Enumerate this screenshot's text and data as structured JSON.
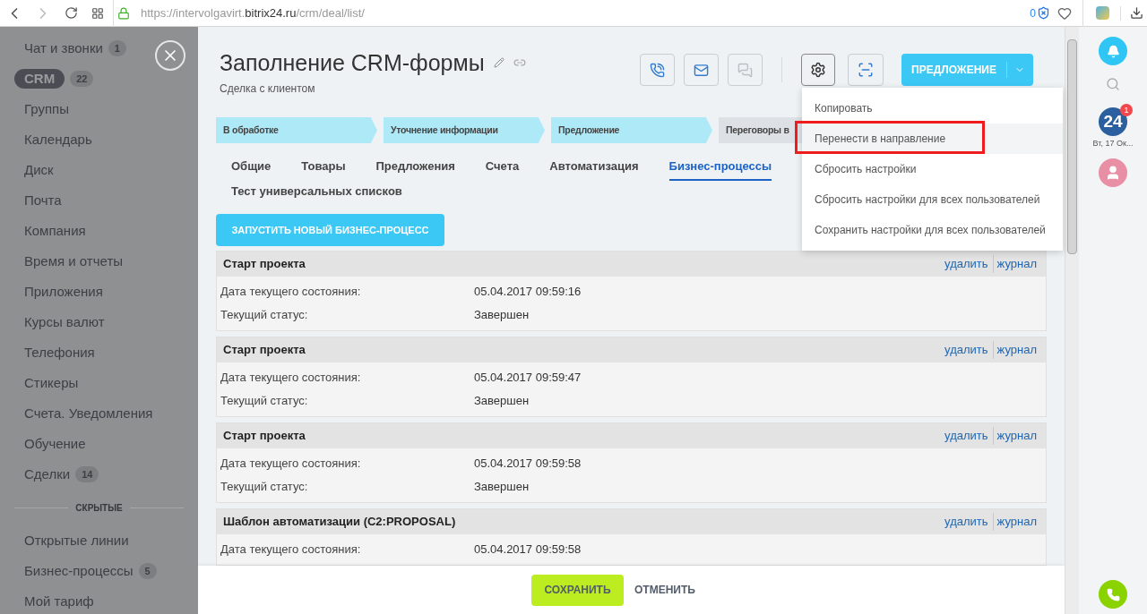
{
  "browser": {
    "url_prefix": "https://intervolgavirt.",
    "url_domain": "bitrix24.ru",
    "url_path": "/crm/deal/list/",
    "blocked_count": "0"
  },
  "sidebar": {
    "items": [
      {
        "label": "Чат и звонки",
        "count": "1",
        "selected": false
      },
      {
        "label": "CRM",
        "count": "22",
        "selected": true
      },
      {
        "label": "Группы",
        "selected": false
      },
      {
        "label": "Календарь",
        "selected": false
      },
      {
        "label": "Диск",
        "selected": false
      },
      {
        "label": "Почта",
        "selected": false
      },
      {
        "label": "Компания",
        "selected": false
      },
      {
        "label": "Время и отчеты",
        "selected": false
      },
      {
        "label": "Приложения",
        "selected": false
      },
      {
        "label": "Курсы валют",
        "selected": false
      },
      {
        "label": "Телефония",
        "selected": false
      },
      {
        "label": "Стикеры",
        "selected": false
      },
      {
        "label": "Счета. Уведомления",
        "selected": false
      },
      {
        "label": "Обучение",
        "selected": false
      },
      {
        "label": "Сделки",
        "count": "14",
        "selected": false
      }
    ],
    "hidden_heading": "СКРЫТЫЕ",
    "hidden_items": [
      {
        "label": "Открытые линии",
        "selected": false
      },
      {
        "label": "Бизнес-процессы",
        "count": "5",
        "selected": false
      },
      {
        "label": "Мой тариф",
        "selected": false
      }
    ]
  },
  "header": {
    "title": "Заполнение CRM-формы",
    "subtitle": "Сделка с клиентом",
    "primary_button": "ПРЕДЛОЖЕНИЕ"
  },
  "stages": [
    {
      "label": "В обработке",
      "passed": true
    },
    {
      "label": "Уточнение информации",
      "passed": true
    },
    {
      "label": "Предложение",
      "passed": true
    },
    {
      "label": "Переговоры в",
      "passed": false
    }
  ],
  "tabs": [
    {
      "label": "Общие",
      "selected": false
    },
    {
      "label": "Товары",
      "selected": false
    },
    {
      "label": "Предложения",
      "selected": false
    },
    {
      "label": "Счета",
      "selected": false
    },
    {
      "label": "Автоматизация",
      "selected": false
    },
    {
      "label": "Бизнес-процессы",
      "selected": true
    },
    {
      "label": "Тест универсальных списков",
      "selected": false
    }
  ],
  "start_button": "ЗАПУСТИТЬ НОВЫЙ БИЗНЕС-ПРОЦЕСС",
  "processes": [
    {
      "title": "Старт проекта",
      "delete": "удалить",
      "log": "журнал",
      "rows": [
        {
          "label": "Дата текущего состояния:",
          "value": "05.04.2017 09:59:16"
        },
        {
          "label": "Текущий статус:",
          "value": "Завершен"
        }
      ]
    },
    {
      "title": "Старт проекта",
      "delete": "удалить",
      "log": "журнал",
      "rows": [
        {
          "label": "Дата текущего состояния:",
          "value": "05.04.2017 09:59:47"
        },
        {
          "label": "Текущий статус:",
          "value": "Завершен"
        }
      ]
    },
    {
      "title": "Старт проекта",
      "delete": "удалить",
      "log": "журнал",
      "rows": [
        {
          "label": "Дата текущего состояния:",
          "value": "05.04.2017 09:59:58"
        },
        {
          "label": "Текущий статус:",
          "value": "Завершен"
        }
      ]
    },
    {
      "title": "Шаблон автоматизации (C2:PROPOSAL)",
      "delete": "удалить",
      "log": "журнал",
      "rows": [
        {
          "label": "Дата текущего состояния:",
          "value": "05.04.2017 09:59:58"
        }
      ]
    }
  ],
  "menu": [
    {
      "label": "Копировать",
      "selected": false,
      "highlighted": false
    },
    {
      "label": "Перенести в направление",
      "selected": true,
      "highlighted": true
    },
    {
      "label": "Сбросить настройки",
      "selected": false,
      "highlighted": false
    },
    {
      "label": "Сбросить настройки для всех пользователей",
      "selected": false,
      "highlighted": false
    },
    {
      "label": "Сохранить настройки для всех пользователей",
      "selected": false,
      "highlighted": false
    }
  ],
  "footer": {
    "save": "СОХРАНИТЬ",
    "cancel": "ОТМЕНИТЬ"
  },
  "right_bar": {
    "portal_logo": "24",
    "badge": "1",
    "date": "Вт, 17 Ок..."
  }
}
